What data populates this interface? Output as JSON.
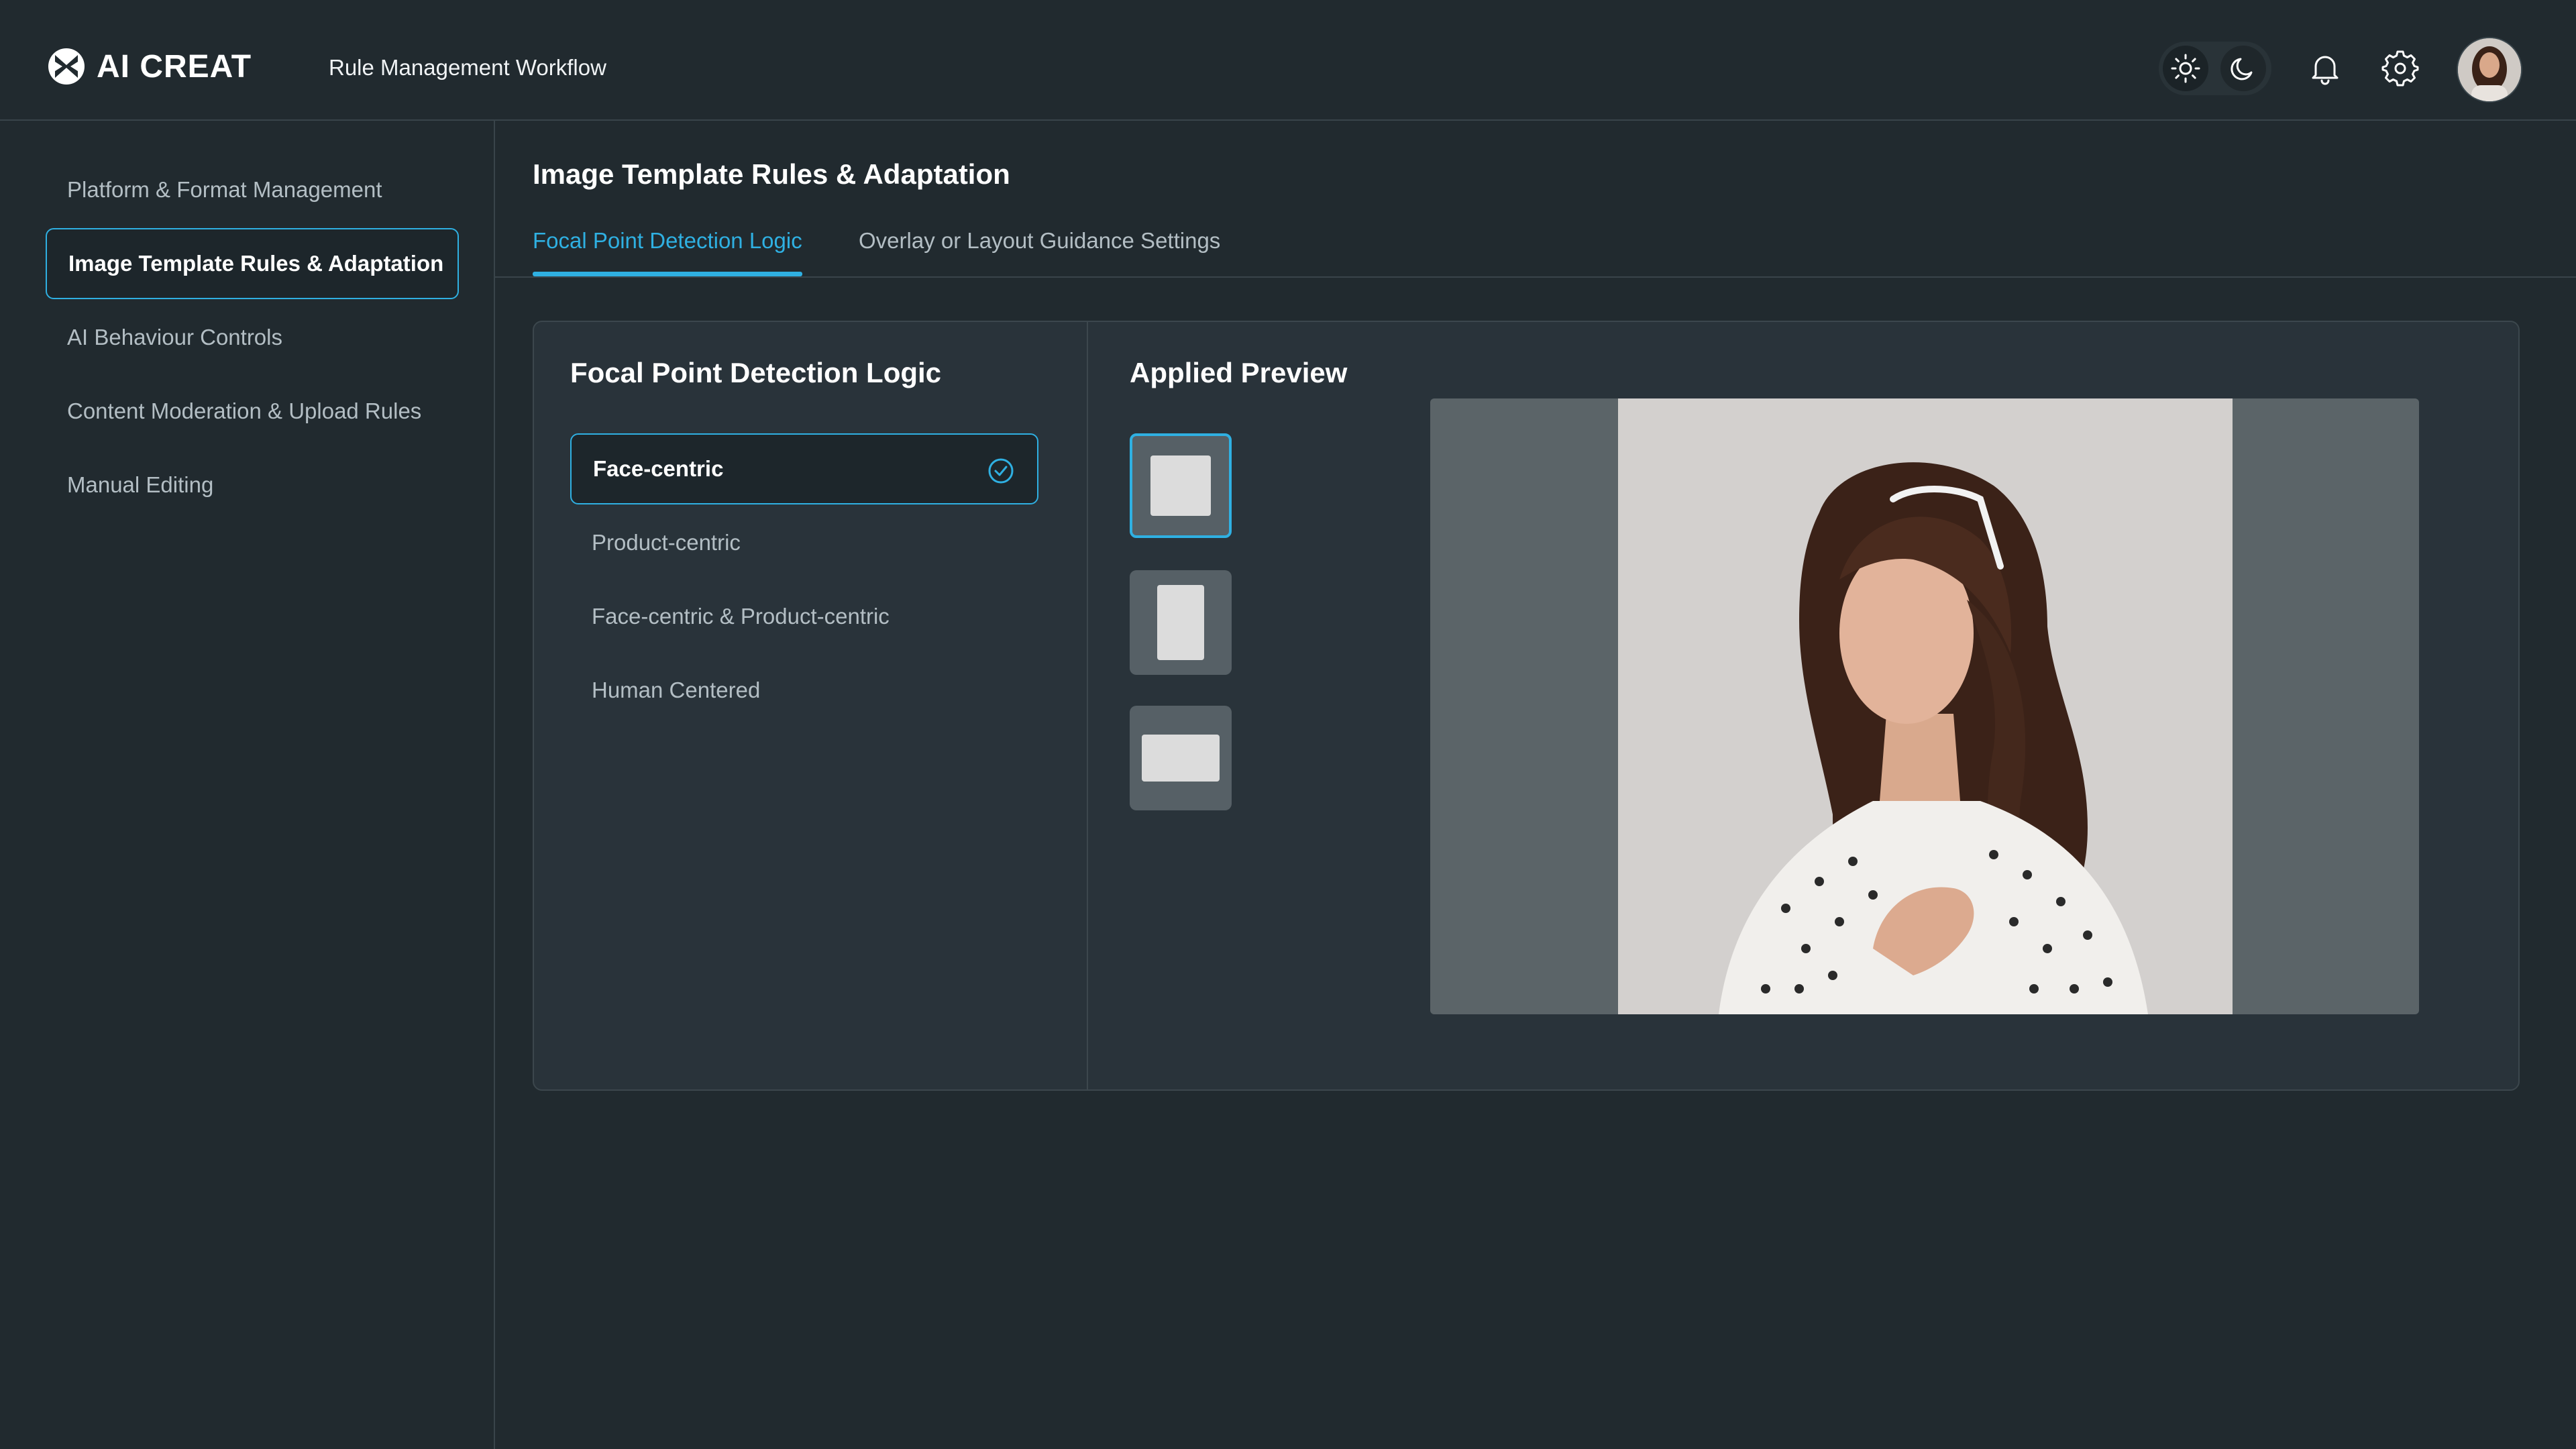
{
  "app": {
    "brand": "AI CREAT",
    "workflow_title": "Rule Management Workflow"
  },
  "header": {
    "theme_toggle": {
      "light_icon": "sun-icon",
      "dark_icon": "moon-icon",
      "selected": "dark"
    },
    "notifications_icon": "bell-icon",
    "settings_icon": "gear-icon",
    "avatar": "user-avatar"
  },
  "sidebar": {
    "items": [
      {
        "label": "Platform & Format Management"
      },
      {
        "label": "Image Template Rules & Adaptation"
      },
      {
        "label": "AI Behaviour Controls"
      },
      {
        "label": "Content Moderation & Upload Rules"
      },
      {
        "label": "Manual Editing"
      }
    ],
    "active": "Image Template Rules & Adaptation"
  },
  "main": {
    "title": "Image Template Rules & Adaptation",
    "tabs": [
      {
        "label": "Focal Point Detection Logic"
      },
      {
        "label": "Overlay or Layout Guidance Settings"
      }
    ],
    "active_tab": "Focal Point Detection Logic"
  },
  "focal_logic": {
    "title": "Focal Point Detection Logic",
    "options": [
      {
        "label": "Face-centric"
      },
      {
        "label": "Product-centric"
      },
      {
        "label": "Face-centric & Product-centric"
      },
      {
        "label": "Human Centered"
      }
    ],
    "selected": "Face-centric"
  },
  "preview": {
    "title": "Applied Preview",
    "aspect_options": [
      "square",
      "portrait",
      "landscape"
    ],
    "selected_aspect": "square"
  },
  "colors": {
    "accent": "#2fb0e2",
    "background": "#212a2f",
    "card": "#29333a",
    "border": "#3c474d",
    "muted_text": "#b3bec4"
  }
}
